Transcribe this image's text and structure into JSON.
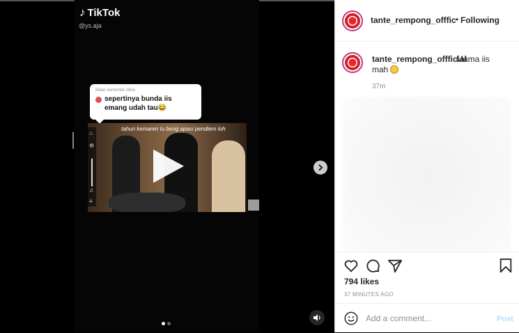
{
  "media": {
    "tiktok_brand": "TikTok",
    "tiktok_handle": "@ys.aja",
    "comment_reply_header": "Balas komentar cilisa",
    "comment_text": "sepertinya bunda iis emang udah tau😂",
    "video_caption": "tahun kemaren tu bong apasi pendiem loh",
    "carousel_count": 2,
    "carousel_active": 0
  },
  "header": {
    "username": "tante_rempong_offficial",
    "separator": "•",
    "follow_status": "Following"
  },
  "caption": {
    "username": "tante_rempong_offficial",
    "text_part1": "Mama iis",
    "text_part2": "mah",
    "emoji": "grinning-sweat-emoji",
    "time_ago": "37m"
  },
  "actions": {
    "likes": "794 likes",
    "posted": "37 MINUTES AGO"
  },
  "comment": {
    "placeholder": "Add a comment...",
    "post_label": "Post"
  },
  "colors": {
    "text_primary": "#262626",
    "text_secondary": "#8e8e8e",
    "post_disabled": "#b2dffc",
    "avatar_ring": "#c13584"
  }
}
